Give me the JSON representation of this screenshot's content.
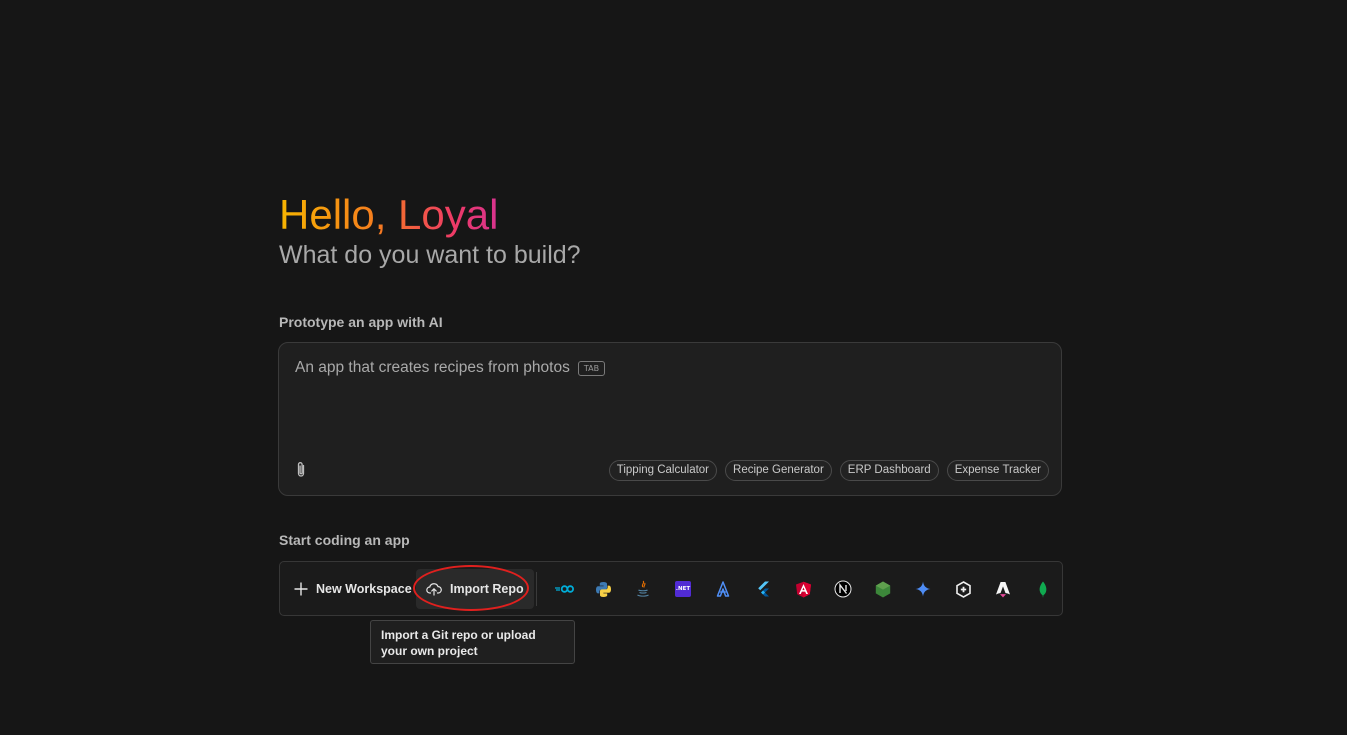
{
  "greeting": "Hello, Loyal",
  "subtitle": "What do you want to build?",
  "prototype": {
    "label": "Prototype an app with AI",
    "placeholder": "An app that creates recipes from photos",
    "tab_hint": "TAB",
    "suggestions": [
      "Tipping Calculator",
      "Recipe Generator",
      "ERP Dashboard",
      "Expense Tracker"
    ]
  },
  "coding": {
    "label": "Start coding an app",
    "new_workspace": "New Workspace",
    "import_repo": "Import Repo",
    "dotnet_label": ".NET",
    "templates": [
      "go-icon",
      "python-icon",
      "java-icon",
      "dotnet-icon",
      "astro-icon",
      "flutter-icon",
      "angular-icon",
      "nextjs-icon",
      "nodejs-icon",
      "gemini-icon",
      "hexagon-icon",
      "astro-a-icon",
      "mongodb-icon"
    ]
  },
  "tooltip": "Import a Git repo or upload your own project",
  "colors": {
    "background": "#161616",
    "highlight": "#e0201e",
    "gradient_start": "#f7b500",
    "gradient_end": "#d9338f"
  }
}
